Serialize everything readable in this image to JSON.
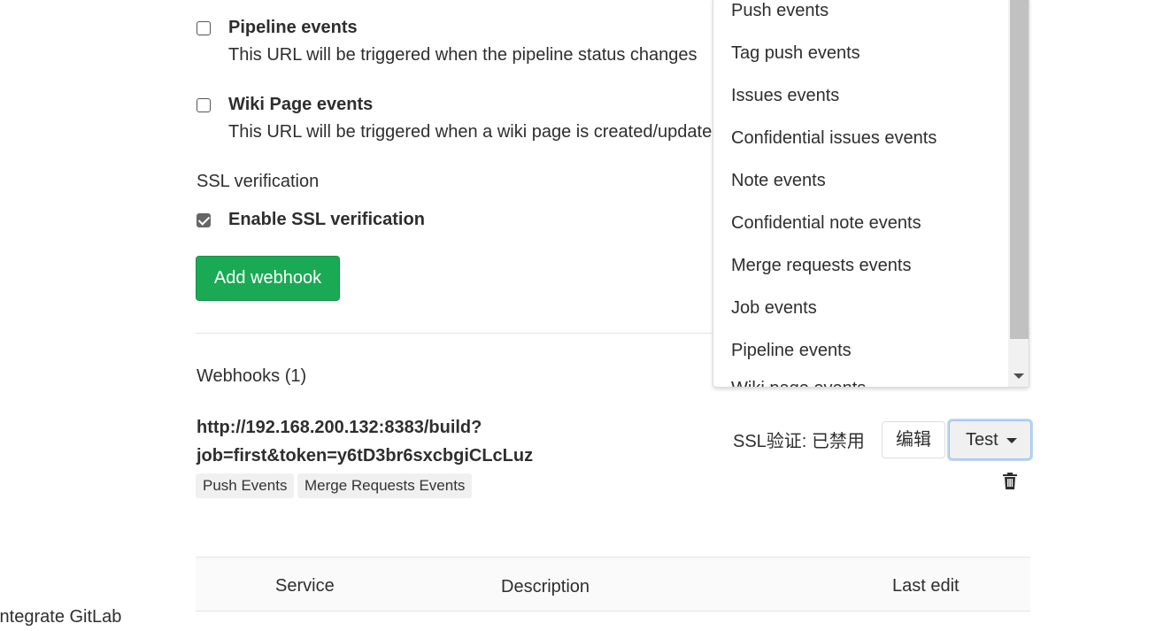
{
  "events": [
    {
      "title": "Pipeline events",
      "description": "This URL will be triggered when the pipeline status changes",
      "checked": false
    },
    {
      "title": "Wiki Page events",
      "description": "This URL will be triggered when a wiki page is created/updated",
      "checked": false
    }
  ],
  "ssl": {
    "section_label": "SSL verification",
    "option_label": "Enable SSL verification",
    "checked": true
  },
  "add_webhook_label": "Add webhook",
  "webhooks": {
    "heading": "Webhooks (1)",
    "items": [
      {
        "url_line1": "http://192.168.200.132:8383/build?",
        "url_line2": "job=first&token=y6tD3br6sxcbgiCLcLuz",
        "tags": [
          "Push Events",
          "Merge Requests Events"
        ],
        "ssl_status": "SSL验证: 已禁用",
        "edit_label": "编辑",
        "test_label": "Test"
      }
    ]
  },
  "test_dropdown": {
    "items": [
      "Push events",
      "Tag push events",
      "Issues events",
      "Confidential issues events",
      "Note events",
      "Confidential note events",
      "Merge requests events",
      "Job events",
      "Pipeline events",
      "Wiki page events"
    ]
  },
  "services_table": {
    "headers": [
      "Service",
      "Description",
      "Last edit"
    ]
  },
  "footer_text": "Integrate GitLab",
  "colors": {
    "primary_green": "#1aaa55",
    "focus_blue": "#bcd7f2"
  }
}
